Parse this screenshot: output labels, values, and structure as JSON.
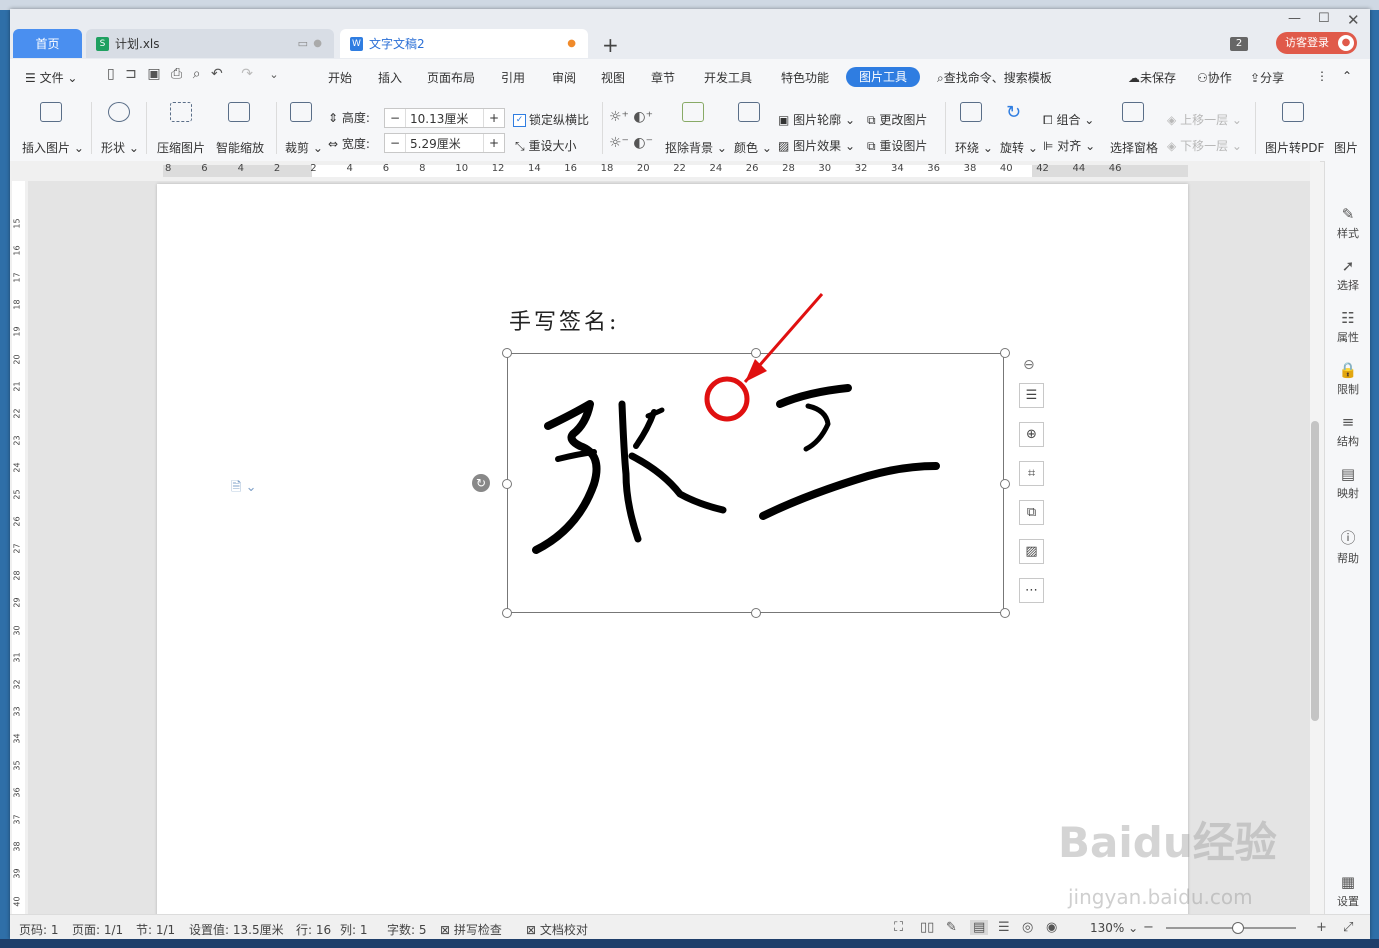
{
  "tabs": {
    "home": "首页",
    "xls": "计划.xls",
    "doc": "文字文稿2"
  },
  "window": {
    "badge": "2",
    "login": "访客登录"
  },
  "menu": {
    "file": "文件",
    "items": [
      "开始",
      "插入",
      "页面布局",
      "引用",
      "审阅",
      "视图",
      "章节",
      "开发工具",
      "特色功能"
    ],
    "active": "图片工具",
    "search": "查找命令、搜索模板",
    "unsaved": "未保存",
    "collab": "协作",
    "share": "分享"
  },
  "ribbon": {
    "insert_image": "插入图片",
    "shape": "形状",
    "compress": "压缩图片",
    "smart_zoom": "智能缩放",
    "crop": "裁剪",
    "height_label": "高度:",
    "height_value": "10.13厘米",
    "width_label": "宽度:",
    "width_value": "5.29厘米",
    "lock_ratio": "锁定纵横比",
    "reset_size": "重设大小",
    "remove_bg": "抠除背景",
    "color": "颜色",
    "outline": "图片轮廓",
    "effect": "图片效果",
    "change_img": "更改图片",
    "reset_img": "重设图片",
    "wrap": "环绕",
    "rotate": "旋转",
    "group": "组合",
    "align": "对齐",
    "select_pane": "选择窗格",
    "bring_forward": "上移一层",
    "send_backward": "下移一层",
    "to_pdf": "图片转PDF",
    "more": "图片"
  },
  "ruler": {
    "top": [
      "8",
      "6",
      "4",
      "2",
      "2",
      "4",
      "6",
      "8",
      "10",
      "12",
      "14",
      "16",
      "18",
      "20",
      "22",
      "24",
      "26",
      "28",
      "30",
      "32",
      "34",
      "36",
      "38",
      "40",
      "42",
      "44",
      "46"
    ],
    "left": [
      "15",
      "16",
      "17",
      "18",
      "19",
      "20",
      "21",
      "22",
      "23",
      "24",
      "25",
      "26",
      "27",
      "28",
      "29",
      "30",
      "31",
      "32",
      "33",
      "34",
      "35",
      "36",
      "37",
      "38",
      "39",
      "40"
    ]
  },
  "document": {
    "heading": "手写签名:",
    "signature_text": "张三"
  },
  "right_panel": [
    "样式",
    "选择",
    "属性",
    "限制",
    "结构",
    "映射",
    "帮助",
    "设置"
  ],
  "status": {
    "page_code": "页码: 1",
    "pages": "页面: 1/1",
    "section": "节: 1/1",
    "setting": "设置值: 13.5厘米",
    "row": "行: 16",
    "col": "列: 1",
    "words": "字数: 5",
    "spell": "拼写检查",
    "proof": "文档校对",
    "zoom": "130%"
  },
  "watermark": {
    "brand": "Baidu经验",
    "url": "jingyan.baidu.com"
  },
  "colors": {
    "accent": "#2f7de1",
    "annotation": "#e01010",
    "login": "#e05a4a"
  }
}
